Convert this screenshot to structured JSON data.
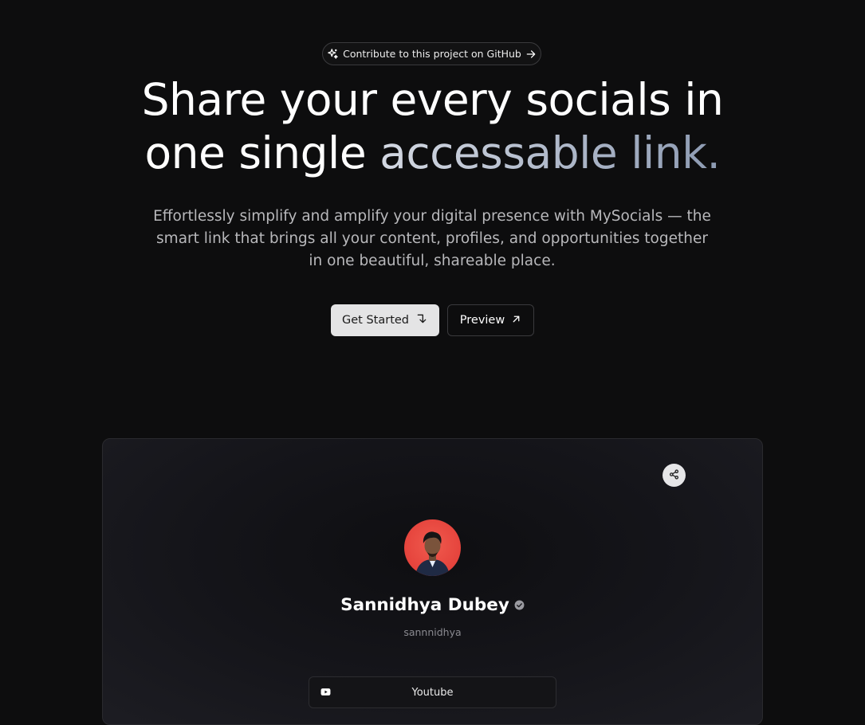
{
  "banner": {
    "label": "Contribute to this project on GitHub"
  },
  "hero": {
    "line1": "Share your every socials in",
    "line2_plain": "one single ",
    "line2_highlight": "accessable link.",
    "subtitle": "Effortlessly simplify and amplify your digital presence with MySocials — the smart link that brings all your content, profiles, and opportunities together in one beautiful, shareable place."
  },
  "actions": {
    "get_started": "Get Started",
    "preview": "Preview"
  },
  "profile": {
    "name": "Sannidhya Dubey",
    "username": "sannnidhya",
    "links": [
      {
        "label": "Youtube",
        "icon": "youtube-icon"
      }
    ]
  },
  "colors": {
    "background": "#0d0d0e",
    "avatar_bg": "#e5433c",
    "primary_button": "#e4e4e5"
  }
}
